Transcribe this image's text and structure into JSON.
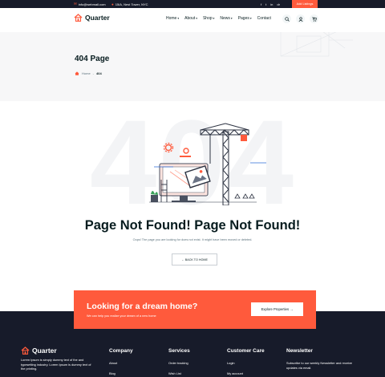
{
  "topbar": {
    "email": "info@webmail.com",
    "address": "15/A, Nest Tower, NYC",
    "social": [
      "f",
      "t",
      "in",
      "dr"
    ],
    "add_listing": "Add Listings"
  },
  "header": {
    "brand": "Quarter",
    "nav": [
      "Home",
      "About",
      "Shop",
      "News",
      "Pages",
      "Contact"
    ],
    "cart_count": "0"
  },
  "banner": {
    "title": "404 Page",
    "breadcrumb_home": "Home",
    "breadcrumb_current": "404"
  },
  "error": {
    "big_number": "404",
    "heading": "Page Not Found! Page Not Found!",
    "message": "Oops! The page you are looking for does not exist. It might have been moved or deleted.",
    "back_label": "← BACK TO HOME"
  },
  "cta": {
    "title": "Looking for a dream home?",
    "subtitle": "We can help you realize your dream of a new home",
    "button": "Explore Properties →"
  },
  "footer": {
    "brand": "Quarter",
    "description": "Lorem Ipsum is simply dummy text of the and typesetting industry. Lorem Ipsum is dummy text of the printing.",
    "columns": [
      {
        "title": "Company",
        "items": [
          "About",
          "Blog"
        ]
      },
      {
        "title": "Services",
        "items": [
          "Order tracking",
          "Wish List"
        ]
      },
      {
        "title": "Customer Care",
        "items": [
          "Login",
          "My account"
        ]
      }
    ],
    "newsletter": {
      "title": "Newsletter",
      "text": "Subscribe to our weekly Newsletter and receive updates via email."
    }
  },
  "colors": {
    "accent": "#ff5a3c",
    "dark": "#171b2a",
    "heading": "#071c1f"
  }
}
